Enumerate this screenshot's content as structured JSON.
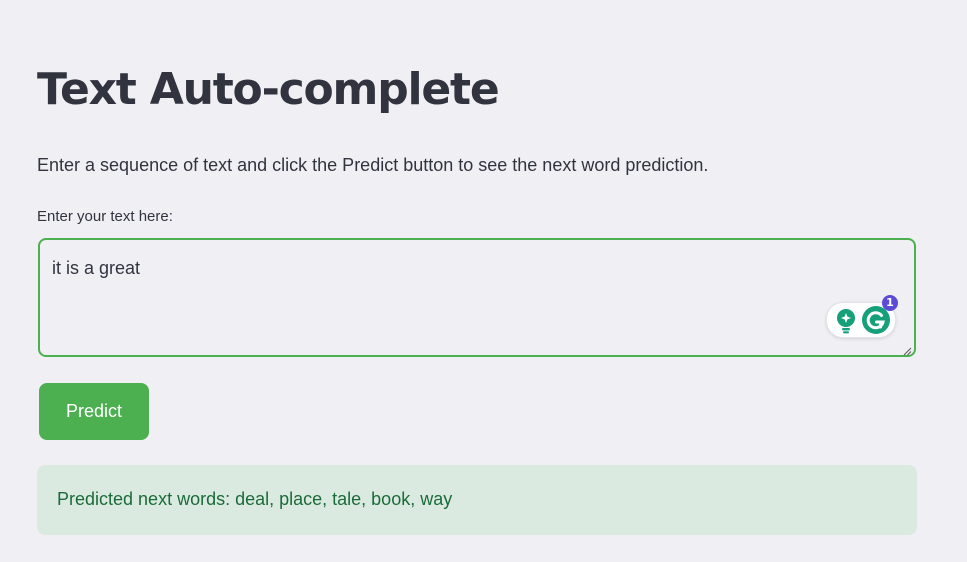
{
  "page": {
    "title": "Text Auto-complete",
    "description": "Enter a sequence of text and click the Predict button to see the next word prediction."
  },
  "input": {
    "label": "Enter your text here:",
    "value": "it is a great"
  },
  "grammarly": {
    "icons": [
      "lightbulb-icon",
      "grammarly-g-icon"
    ],
    "badge_count": "1"
  },
  "button": {
    "predict_label": "Predict"
  },
  "result": {
    "text": "Predicted next words: deal, place, tale, book, way"
  },
  "colors": {
    "accent_green": "#4caf50",
    "success_bg": "#dbeae1",
    "success_text": "#1b6b3a",
    "page_bg": "#f0f0f4",
    "text": "#31333f",
    "grammarly_green": "#15a07a",
    "badge_purple": "#5b4bd6"
  }
}
